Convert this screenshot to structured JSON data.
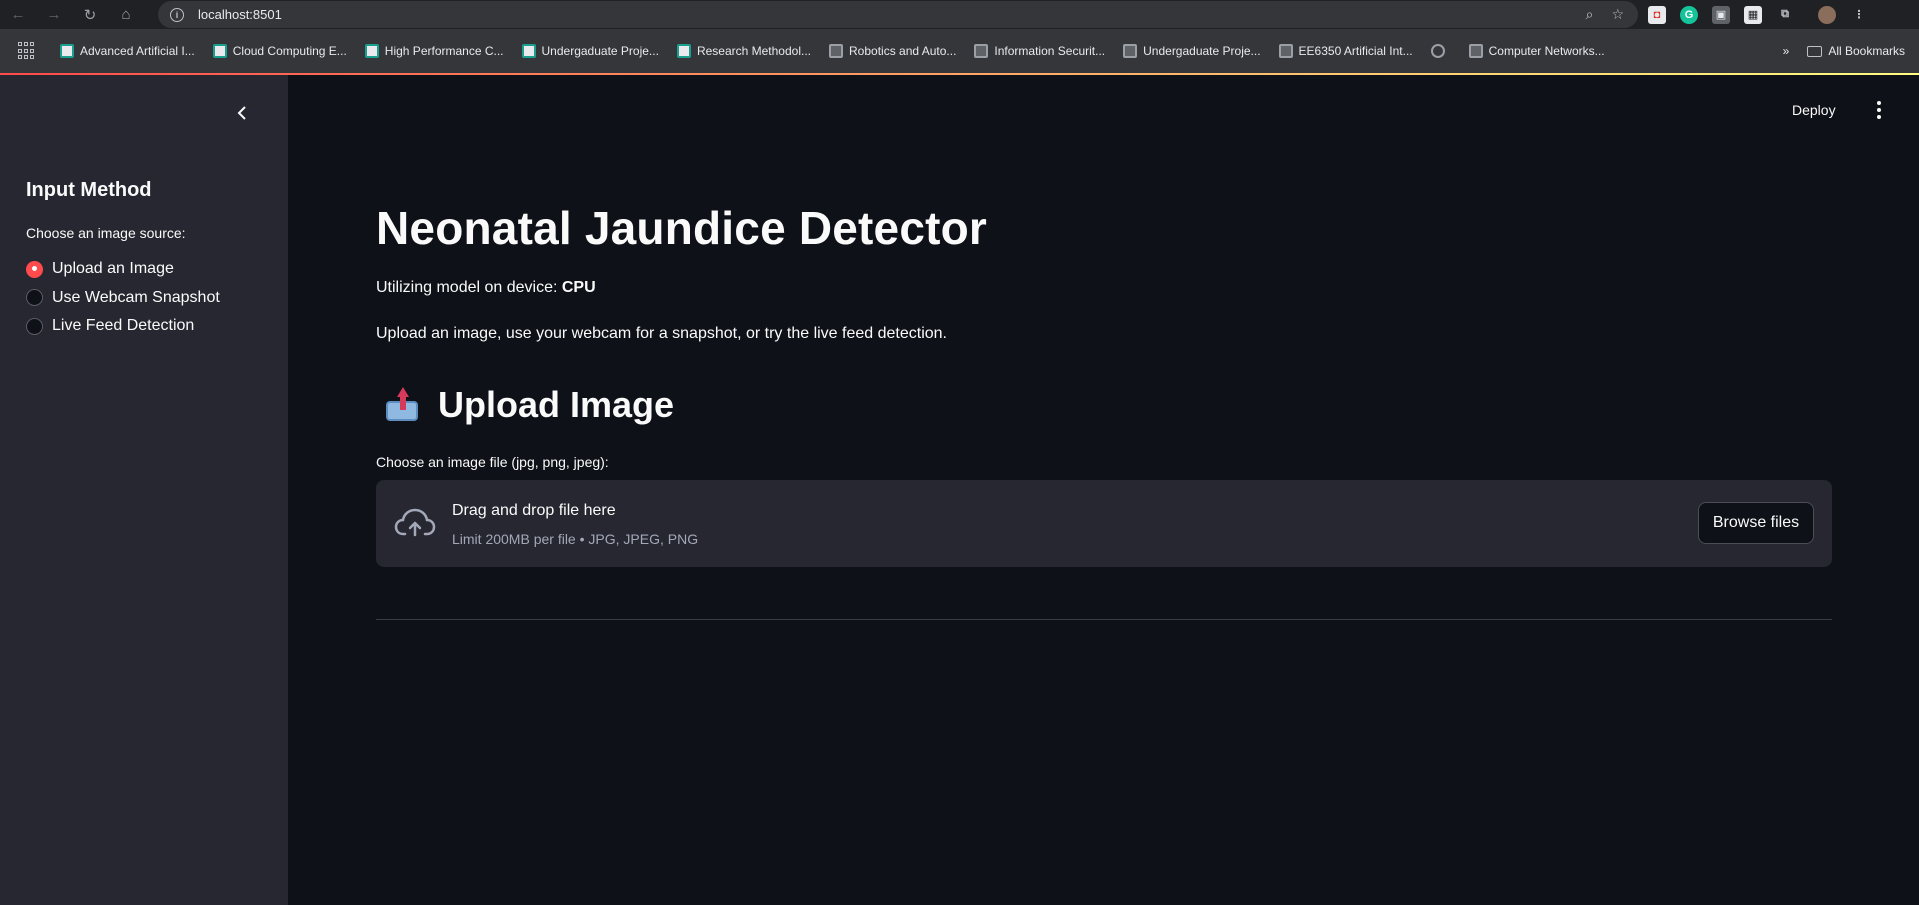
{
  "browser": {
    "url": "localhost:8501",
    "bookmarks": [
      {
        "label": "Advanced Artificial I..."
      },
      {
        "label": "Cloud Computing E..."
      },
      {
        "label": "High Performance C..."
      },
      {
        "label": "Undergaduate Proje..."
      },
      {
        "label": "Research Methodol..."
      },
      {
        "label": "Robotics and Auto..."
      },
      {
        "label": "Information Securit..."
      },
      {
        "label": "Undergaduate Proje..."
      },
      {
        "label": "EE6350 Artificial Int..."
      },
      {
        "label": "Computer Networks..."
      }
    ],
    "all_bookmarks_label": "All Bookmarks",
    "overflow_label": "»"
  },
  "sidebar": {
    "title": "Input Method",
    "radio_label": "Choose an image source:",
    "options": [
      {
        "label": "Upload an Image",
        "selected": true
      },
      {
        "label": "Use Webcam Snapshot",
        "selected": false
      },
      {
        "label": "Live Feed Detection",
        "selected": false
      }
    ]
  },
  "header": {
    "deploy_label": "Deploy"
  },
  "main": {
    "title": "Neonatal Jaundice Detector",
    "device_prefix": "Utilizing model on device: ",
    "device_value": "CPU",
    "description": "Upload an image, use your webcam for a snapshot, or try the live feed detection.",
    "section_title": "Upload Image",
    "uploader": {
      "label": "Choose an image file (jpg, png, jpeg):",
      "drop_title": "Drag and drop file here",
      "drop_subtitle": "Limit 200MB per file • JPG, JPEG, PNG",
      "browse_label": "Browse files"
    }
  },
  "colors": {
    "accent": "#ff4b4b",
    "background": "#0e1117",
    "sidebar": "#262730"
  }
}
